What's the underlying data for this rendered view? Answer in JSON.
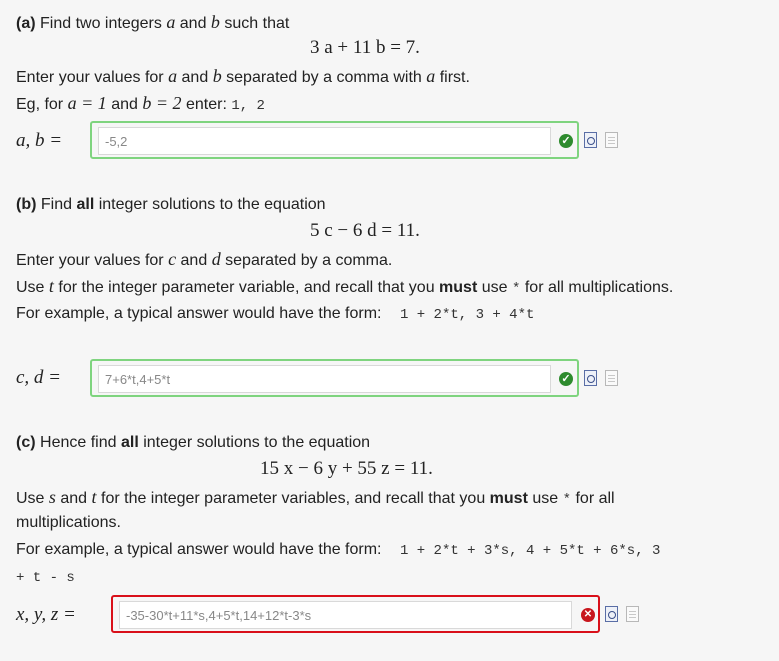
{
  "a": {
    "prompt_pre": "Find two integers",
    "prompt_and": "and",
    "prompt_post": "such that",
    "var_a": "a",
    "var_b": "b",
    "equation": "3 a + 11 b = 7.",
    "instr_pre": "Enter your values for",
    "instr_mid": "and",
    "instr_post": "separated by a comma with",
    "instr_end": "first.",
    "eg_pre": "Eg, for",
    "eg_a": "a = 1",
    "eg_and": "and",
    "eg_b": "b = 2",
    "eg_enter": "enter:",
    "eg_code": "1, 2",
    "label": "a, b =",
    "value": "-5,2",
    "part": "(a)"
  },
  "b": {
    "part": "(b)",
    "prompt_pre": "Find",
    "prompt_bold": "all",
    "prompt_post": "integer solutions to the equation",
    "equation": "5 c − 6 d = 11.",
    "instr_pre": "Enter your values for",
    "var_c": "c",
    "var_d": "d",
    "instr_mid": "and",
    "instr_post": "separated by a comma.",
    "use_pre": "Use",
    "var_t": "t",
    "use_mid": "for the integer parameter variable, and recall that you",
    "use_bold": "must",
    "use_post": "use",
    "use_star": "*",
    "use_end": "for all multiplications.",
    "example_pre": "For example, a typical answer would have the form:",
    "example_code": "1 + 2*t, 3 + 4*t",
    "label": "c, d =",
    "value": "7+6*t,4+5*t"
  },
  "c": {
    "part": "(c)",
    "prompt_pre": "Hence find",
    "prompt_bold": "all",
    "prompt_post": "integer solutions to the equation",
    "equation": "15 x − 6 y + 55 z = 11.",
    "use_pre": "Use",
    "var_s": "s",
    "use_and": "and",
    "var_t": "t",
    "use_mid": "for the integer parameter variables, and recall that you",
    "use_bold": "must",
    "use_post": "use",
    "use_star": "*",
    "use_end": "for all",
    "use_line2": "multiplications.",
    "example_pre": "For example, a typical answer would have the form:",
    "example_code": "1 + 2*t + 3*s, 4 + 5*t + 6*s, 3",
    "example_code2": "+ t - s",
    "label": "x, y, z =",
    "value": "-35-30*t+11*s,4+5*t,14+12*t-3*s"
  },
  "status": {
    "ok_icon": "check-circle-icon",
    "bad_icon": "cross-circle-icon",
    "ok_color": "#7fd47f",
    "bad_color": "#d9101a"
  }
}
